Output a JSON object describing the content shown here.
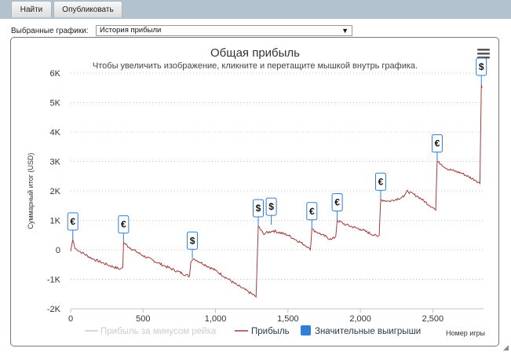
{
  "toolbar": {
    "tabs": [
      {
        "label": "Найти"
      },
      {
        "label": "Опубликовать"
      }
    ]
  },
  "selector": {
    "label": "Выбранные графики:",
    "value": "История прибыли",
    "arrow": "▼"
  },
  "menu_icon": "hamburger-menu-icon",
  "colors": {
    "profit_line": "#a33a3a",
    "net_line": "#d9d9d9",
    "big_wins": "#2f7ed8",
    "marker_border": "#2f7ed8"
  },
  "chart_data": {
    "type": "line",
    "title": "Общая прибыль",
    "subtitle": "Чтобы увеличить изображение, кликните и перетащите мышкой внутрь графика.",
    "xlabel": "Номер игры",
    "ylabel": "Суммарный итог (USD)",
    "xlim": [
      0,
      2850
    ],
    "ylim": [
      -2000,
      6000
    ],
    "x_ticks": [
      0,
      500,
      1000,
      1500,
      2000,
      2500
    ],
    "x_tick_labels": [
      "0",
      "500",
      "1,000",
      "1,500",
      "2,000",
      "2,500"
    ],
    "y_ticks": [
      -2000,
      -1000,
      0,
      1000,
      2000,
      3000,
      4000,
      5000,
      6000
    ],
    "y_tick_labels": [
      "-2K",
      "-1K",
      "0",
      "1K",
      "2K",
      "3K",
      "4K",
      "5K",
      "6K"
    ],
    "grid": "horizontal dotted",
    "legend_position": "bottom",
    "series": [
      {
        "name": "Прибыль за минусом рейка",
        "values": []
      },
      {
        "name": "Прибыль",
        "points": [
          [
            0,
            -50
          ],
          [
            15,
            350
          ],
          [
            30,
            50
          ],
          [
            80,
            -100
          ],
          [
            150,
            -300
          ],
          [
            250,
            -500
          ],
          [
            340,
            -650
          ],
          [
            360,
            -600
          ],
          [
            365,
            250
          ],
          [
            400,
            100
          ],
          [
            500,
            -200
          ],
          [
            650,
            -550
          ],
          [
            820,
            -900
          ],
          [
            830,
            -400
          ],
          [
            850,
            -300
          ],
          [
            1000,
            -700
          ],
          [
            1150,
            -1200
          ],
          [
            1270,
            -1550
          ],
          [
            1280,
            -1600
          ],
          [
            1295,
            800
          ],
          [
            1330,
            550
          ],
          [
            1400,
            650
          ],
          [
            1500,
            500
          ],
          [
            1640,
            100
          ],
          [
            1655,
            0
          ],
          [
            1665,
            700
          ],
          [
            1700,
            600
          ],
          [
            1800,
            350
          ],
          [
            1830,
            450
          ],
          [
            1840,
            1000
          ],
          [
            1900,
            850
          ],
          [
            2000,
            700
          ],
          [
            2120,
            450
          ],
          [
            2130,
            500
          ],
          [
            2140,
            1700
          ],
          [
            2200,
            1650
          ],
          [
            2300,
            1800
          ],
          [
            2320,
            2000
          ],
          [
            2400,
            1800
          ],
          [
            2510,
            1400
          ],
          [
            2520,
            1350
          ],
          [
            2530,
            3000
          ],
          [
            2560,
            2900
          ],
          [
            2600,
            2750
          ],
          [
            2700,
            2600
          ],
          [
            2800,
            2350
          ],
          [
            2825,
            2250
          ],
          [
            2835,
            5600
          ],
          [
            2840,
            5500
          ]
        ]
      },
      {
        "name": "Значительные выигрыши",
        "values": []
      }
    ],
    "markers": [
      {
        "x": 15,
        "y": 350,
        "label": "€"
      },
      {
        "x": 365,
        "y": 250,
        "label": "€"
      },
      {
        "x": 840,
        "y": -300,
        "label": "$"
      },
      {
        "x": 1295,
        "y": 800,
        "label": "$"
      },
      {
        "x": 1385,
        "y": 850,
        "label": "$"
      },
      {
        "x": 1665,
        "y": 700,
        "label": "€"
      },
      {
        "x": 1840,
        "y": 1000,
        "label": "€"
      },
      {
        "x": 2140,
        "y": 1700,
        "label": "€"
      },
      {
        "x": 2530,
        "y": 3000,
        "label": "€"
      },
      {
        "x": 2835,
        "y": 5600,
        "label": "$"
      }
    ]
  }
}
